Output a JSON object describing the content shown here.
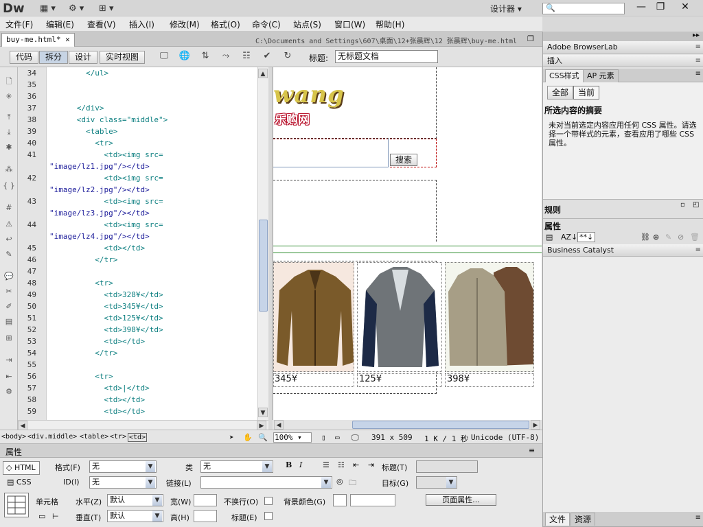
{
  "app": {
    "logo": "Dw",
    "workspace": "设计器",
    "window_controls": [
      "minimize-icon",
      "restore-icon",
      "close-icon"
    ]
  },
  "menubar": [
    "文件(F)",
    "编辑(E)",
    "查看(V)",
    "插入(I)",
    "修改(M)",
    "格式(O)",
    "命令(C)",
    "站点(S)",
    "窗口(W)",
    "帮助(H)"
  ],
  "document": {
    "tab": "buy-me.html*",
    "path": "C:\\Documents and Settings\\607\\桌面\\12+张晨辉\\12 张晨辉\\buy-me.html"
  },
  "toolbar": {
    "views": [
      "代码",
      "拆分",
      "设计",
      "实时视图"
    ],
    "active_view": "拆分",
    "title_label": "标题:",
    "title_value": "无标题文档"
  },
  "code": {
    "line_numbers": [
      "34",
      "35",
      "36",
      "37",
      "38",
      "39",
      "40",
      "41",
      "",
      "42",
      "",
      "43",
      "",
      "44",
      "",
      "45",
      "46",
      "47",
      "48",
      "49",
      "50",
      "51",
      "52",
      "53",
      "54",
      "55",
      "56",
      "57",
      "58",
      "59"
    ],
    "lines": [
      {
        "indent": "        ",
        "text": "</ul>"
      },
      {
        "indent": "",
        "text": ""
      },
      {
        "indent": "",
        "text": ""
      },
      {
        "indent": "      ",
        "text": "</div>"
      },
      {
        "indent": "      ",
        "text": "<div class=\"middle\">"
      },
      {
        "indent": "        ",
        "text": "<table>"
      },
      {
        "indent": "          ",
        "text": "<tr>"
      },
      {
        "indent": "            ",
        "text": "<td><img src="
      },
      {
        "indent": "",
        "text": "\"image/lz1.jpg\"/></td>"
      },
      {
        "indent": "            ",
        "text": "<td><img src="
      },
      {
        "indent": "",
        "text": "\"image/lz2.jpg\"/></td>"
      },
      {
        "indent": "            ",
        "text": "<td><img src="
      },
      {
        "indent": "",
        "text": "\"image/lz3.jpg\"/></td>"
      },
      {
        "indent": "            ",
        "text": "<td><img src="
      },
      {
        "indent": "",
        "text": "\"image/lz4.jpg\"/></td>"
      },
      {
        "indent": "            ",
        "text": "<td></td>"
      },
      {
        "indent": "          ",
        "text": "</tr>"
      },
      {
        "indent": "",
        "text": ""
      },
      {
        "indent": "          ",
        "text": "<tr>"
      },
      {
        "indent": "            ",
        "text": "<td>328¥</td>"
      },
      {
        "indent": "            ",
        "text": "<td>345¥</td>"
      },
      {
        "indent": "            ",
        "text": "<td>125¥</td>"
      },
      {
        "indent": "            ",
        "text": "<td>398¥</td>"
      },
      {
        "indent": "            ",
        "text": "<td></td>"
      },
      {
        "indent": "          ",
        "text": "</tr>"
      },
      {
        "indent": "",
        "text": ""
      },
      {
        "indent": "          ",
        "text": "<tr>"
      },
      {
        "indent": "            ",
        "text": "<td>|</td>"
      },
      {
        "indent": "            ",
        "text": "<td></td>"
      },
      {
        "indent": "            ",
        "text": "<td></td>"
      }
    ]
  },
  "design": {
    "logo_text": "wang",
    "logo_subtext": "乐购网",
    "search_button": "搜索",
    "prices": [
      "345¥",
      "125¥",
      "398¥"
    ],
    "product_colors": [
      "#7a5a2a",
      "#6f7478",
      "#a79e86",
      "#6e4b32"
    ]
  },
  "status": {
    "breadcrumb": [
      "<body>",
      "<div.middle>",
      "<table>",
      "<tr>",
      "<td>"
    ],
    "zoom": "100%",
    "dimensions": "391 x 509",
    "size_time": "1 K / 1 秒",
    "encoding": "Unicode (UTF-8)"
  },
  "properties": {
    "title": "属性",
    "html_tab": "HTML",
    "css_tab": "CSS",
    "format_label": "格式(F)",
    "format_value": "无",
    "class_label": "类",
    "class_value": "无",
    "id_label": "ID(I)",
    "id_value": "无",
    "link_label": "链接(L)",
    "title_label": "标题(T)",
    "target_label": "目标(G)",
    "cell_label": "单元格",
    "horiz_label": "水平(Z)",
    "horiz_value": "默认",
    "vert_label": "垂直(T)",
    "vert_value": "默认",
    "width_label": "宽(W)",
    "height_label": "高(H)",
    "nowrap_label": "不换行(O)",
    "header_label": "标题(E)",
    "bgcolor_label": "背景颜色(G)",
    "page_props_button": "页面属性..."
  },
  "rightpanel": {
    "browserlab": "Adobe BrowserLab",
    "insert": "插入",
    "css_tab": "CSS样式",
    "ap_tab": "AP 元素",
    "all_btn": "全部",
    "current_btn": "当前",
    "summary_title": "所选内容的摘要",
    "summary_text": "未对当前选定内容应用任何 CSS 属性。请选择一个带样式的元素，查看应用了哪些 CSS 属性。",
    "rules_title": "规则",
    "props_title": "属性",
    "business_catalyst": "Business Catalyst",
    "bottom_tabs": [
      "文件",
      "资源"
    ]
  }
}
